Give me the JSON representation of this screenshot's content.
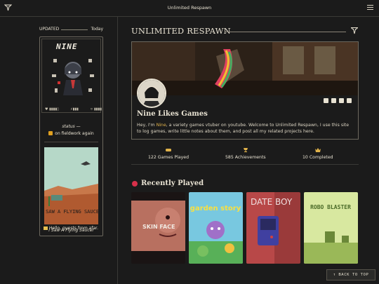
{
  "app": {
    "title": "Unlimited Respawn"
  },
  "sidebar": {
    "updated_label": "UPDATED",
    "updated_value": "Today",
    "card": {
      "name": "NINE",
      "stats": [
        "♥ ▮▮▮▮▯",
        "⚡▮▮▮",
        "⚪ ▮▮▮▮"
      ],
      "status_label": "status —",
      "status_value": "on fieldwork again",
      "poster_caption": "I Saw A Flying Saucer",
      "poster_text": "I SAW A FLYING SAUCER"
    },
    "greeting": "Hello, guests from afar."
  },
  "main": {
    "title": "UNLIMITED RESPAWN",
    "profile": {
      "name": "Nine Likes Games",
      "bio_pre": "Hey, I'm ",
      "bio_name": "Nine",
      "bio_post": ", a variety games vtuber on youtube. Welcome to Unlimited Respawn, I use this site to log games, write little notes about them, and post all my related projects here.",
      "socials": [
        "tumblr-icon",
        "twitch-icon",
        "youtube-icon",
        "discord-icon"
      ]
    },
    "stats": [
      {
        "label": "122 Games Played",
        "icon": "gamepad-icon"
      },
      {
        "label": "585 Achievements",
        "icon": "trophy-icon"
      },
      {
        "label": "10 Completed",
        "icon": "crown-icon"
      }
    ],
    "recently_played": {
      "title": "Recently Played",
      "games": [
        {
          "name": "Skin Face",
          "text": "SKIN FACE"
        },
        {
          "name": "Garden Story",
          "text": "garden story"
        },
        {
          "name": "Date Boy",
          "text": "DATE BOY"
        },
        {
          "name": "Robo Blaster",
          "text": "ROBO BLASTER"
        }
      ]
    }
  },
  "back_to_top": "↑ BACK TO TOP",
  "colors": {
    "accent": "#e0b24a",
    "bg": "#1b1b1b",
    "text": "#e8e2d2",
    "red_dot": "#d8304a"
  }
}
